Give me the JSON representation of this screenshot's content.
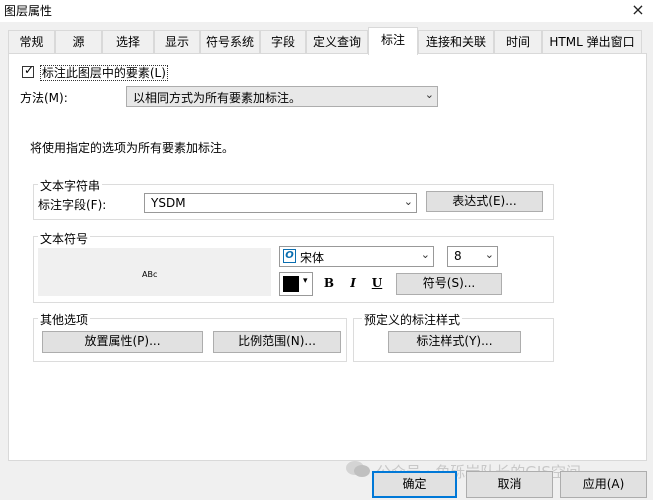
{
  "window": {
    "title": "图层属性",
    "close_label": "×"
  },
  "tabs": [
    {
      "label": "常规"
    },
    {
      "label": "源"
    },
    {
      "label": "选择"
    },
    {
      "label": "显示"
    },
    {
      "label": "符号系统"
    },
    {
      "label": "字段"
    },
    {
      "label": "定义查询"
    },
    {
      "label": "标注"
    },
    {
      "label": "连接和关联"
    },
    {
      "label": "时间"
    },
    {
      "label": "HTML 弹出窗口"
    }
  ],
  "active_tab": "标注",
  "label_checkbox": {
    "label": "标注此图层中的要素(L)",
    "checked": true
  },
  "method": {
    "label": "方法(M):",
    "value": "以相同方式为所有要素加标注。"
  },
  "info_text": "将使用指定的选项为所有要素加标注。",
  "text_string": {
    "title": "文本字符串",
    "field_label": "标注字段(F):",
    "field_value": "YSDM",
    "expression_button": "表达式(E)..."
  },
  "text_symbol": {
    "title": "文本符号",
    "preview_text": "ABc",
    "font_value": "宋体",
    "font_icon": "O",
    "size_value": "8",
    "bold_label": "B",
    "italic_label": "I",
    "underline_label": "U",
    "symbol_button": "符号(S)...",
    "color": "#000000"
  },
  "other_options": {
    "title": "其他选项",
    "placement_button": "放置属性(P)...",
    "scale_button": "比例范围(N)..."
  },
  "predefined": {
    "title": "预定义的标注样式",
    "style_button": "标注样式(Y)..."
  },
  "footer": {
    "ok": "确定",
    "cancel": "取消",
    "apply": "应用(A)"
  },
  "watermark": "公众号 · 角砾岩队长的GIS空间"
}
